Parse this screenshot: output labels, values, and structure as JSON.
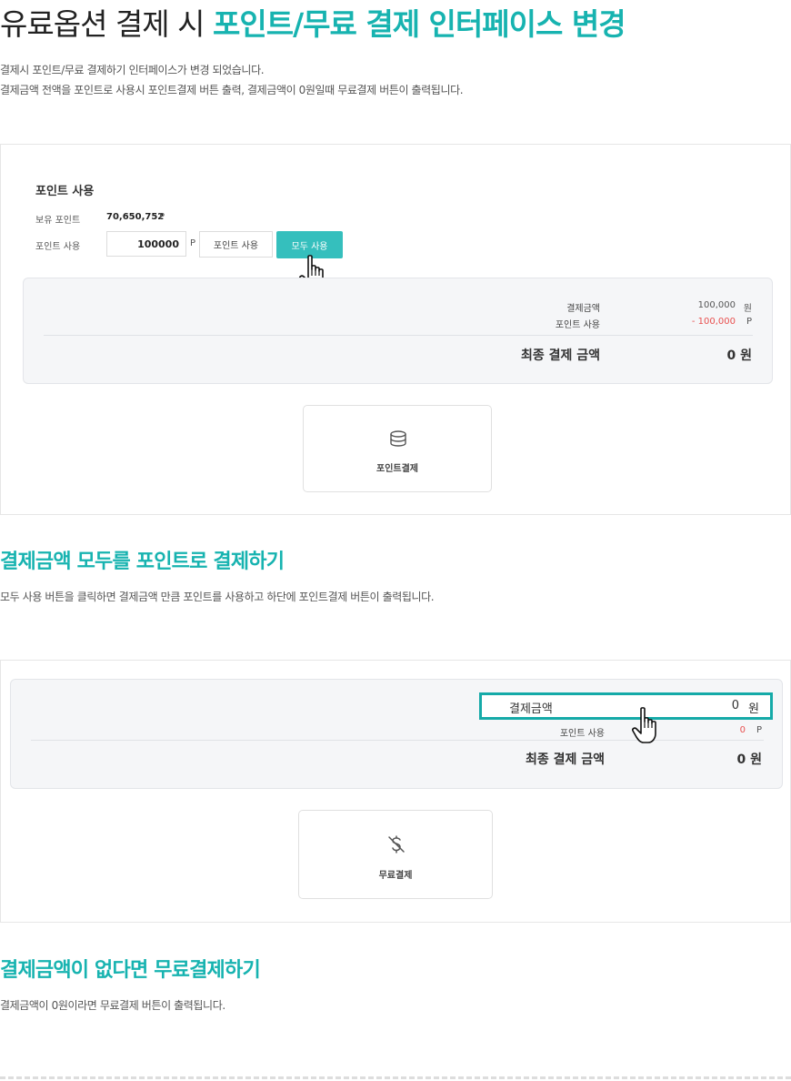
{
  "header": {
    "title_plain": "유료옵션 결제 시 ",
    "title_highlight": "포인트/무료 결제 인터페이스 변경",
    "desc_line1": "결제시 포인트/무료 결제하기 인터페이스가 변경 되었습니다.",
    "desc_line2": "결제금액 전액을 포인트로 사용시 포인트결제 버튼 출력, 결제금액이 0원일때 무료결제 버튼이 출력됩니다."
  },
  "panel1": {
    "section_title": "포인트 사용",
    "held_label": "보유 포인트",
    "held_value": "70,650,752",
    "held_unit": "P",
    "use_label": "포인트 사용",
    "input_value": "100000",
    "input_unit": "P",
    "use_button": "포인트 사용",
    "use_all_button": "모두 사용",
    "summary": {
      "amount_label": "결제금액",
      "amount_value": "100,000",
      "amount_unit": "원",
      "points_label": "포인트 사용",
      "points_value": "- 100,000",
      "points_unit": "P",
      "final_label": "최종 결제 금액",
      "final_value": "0 원"
    },
    "pay_button": "포인트결제",
    "pay_icon": "database-icon"
  },
  "section2": {
    "title": "결제금액 모두를 포인트로 결제하기",
    "desc": "모두 사용 버튼을 클릭하면 결제금액 만큼 포인트를 사용하고 하단에 포인트결제 버튼이 출력됩니다."
  },
  "panel2": {
    "summary": {
      "amount_label": "결제금액",
      "amount_value": "0",
      "amount_unit": "원",
      "points_label": "포인트 사용",
      "points_value": "0",
      "points_unit": "P",
      "final_label": "최종 결제 금액",
      "final_value": "0 원"
    },
    "pay_button": "무료결제",
    "pay_icon": "dollar-off-icon"
  },
  "section3": {
    "title": "결제금액이 없다면 무료결제하기",
    "desc": "결제금액이 0원이라면 무료결제 버튼이 출력됩니다."
  },
  "colors": {
    "accent": "#17b3b0",
    "button": "#35bfbd",
    "negative": "#e8504f"
  }
}
